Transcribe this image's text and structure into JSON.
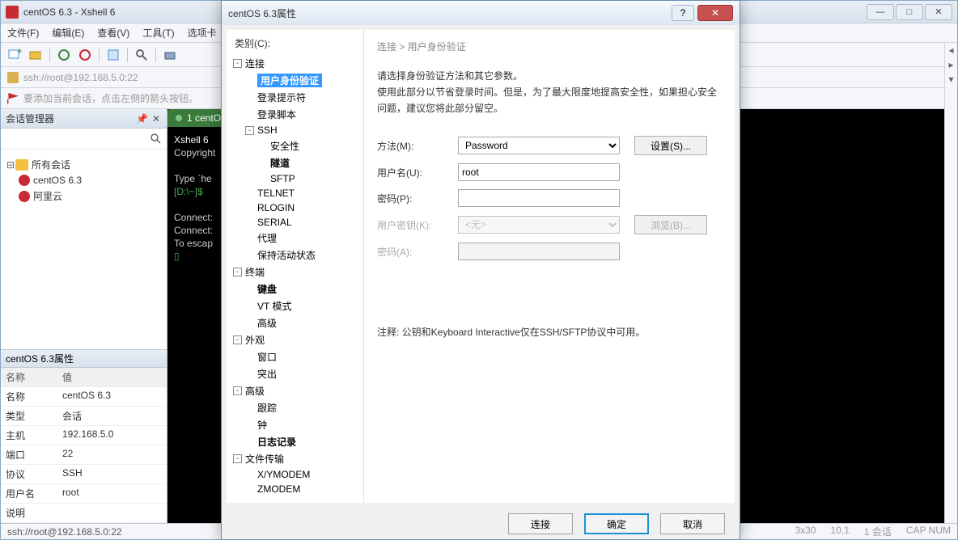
{
  "mainWindow": {
    "title": "centOS 6.3 - Xshell 6",
    "menu": [
      "文件(F)",
      "编辑(E)",
      "查看(V)",
      "工具(T)",
      "选项卡"
    ],
    "address": "ssh://root@192.168.5.0:22",
    "hint": "要添加当前会话，点击左侧的箭头按钮。"
  },
  "sidebar": {
    "title": "会话管理器",
    "root": "所有会话",
    "sessions": [
      "centOS 6.3",
      "阿里云"
    ]
  },
  "props": {
    "header": "centOS 6.3属性",
    "cols": {
      "name": "名称",
      "value": "值"
    },
    "rows": [
      {
        "k": "名称",
        "v": "centOS 6.3"
      },
      {
        "k": "类型",
        "v": "会话"
      },
      {
        "k": "主机",
        "v": "192.168.5.0"
      },
      {
        "k": "端口",
        "v": "22"
      },
      {
        "k": "协议",
        "v": "SSH"
      },
      {
        "k": "用户名",
        "v": "root"
      },
      {
        "k": "说明",
        "v": ""
      }
    ]
  },
  "terminal": {
    "tab": "1 centO",
    "line1": "Xshell 6",
    "line2": "Copyright",
    "line3": "Type `he",
    "prompt": "[D:\\~]$",
    "line5": "Connect:",
    "line6": "Connect:",
    "line7": "To escap"
  },
  "status": {
    "left": "ssh://root@192.168.5.0:22",
    "r1": "3x30",
    "r2": "10,1",
    "r3": "1 会话",
    "r4": "CAP  NUM"
  },
  "dialog": {
    "title": "centOS 6.3属性",
    "catLabel": "类别(C):",
    "tree": {
      "connection": "连接",
      "auth": "用户身份验证",
      "loginPrompt": "登录提示符",
      "loginScript": "登录脚本",
      "ssh": "SSH",
      "security": "安全性",
      "tunnel": "隧道",
      "sftp": "SFTP",
      "telnet": "TELNET",
      "rlogin": "RLOGIN",
      "serial": "SERIAL",
      "proxy": "代理",
      "keepalive": "保持活动状态",
      "terminal": "终端",
      "keyboard": "键盘",
      "vtmode": "VT 模式",
      "advanced1": "高级",
      "appearance": "外观",
      "window": "窗口",
      "highlight": "突出",
      "advanced2": "高级",
      "trace": "跟踪",
      "bell": "钟",
      "log": "日志记录",
      "filetransfer": "文件传输",
      "xymodem": "X/YMODEM",
      "zmodem": "ZMODEM"
    },
    "breadcrumb": "连接 > 用户身份验证",
    "desc1": "请选择身份验证方法和其它参数。",
    "desc2": "使用此部分以节省登录时间。但是，为了最大限度地提高安全性，如果担心安全问题，建议您将此部分留空。",
    "form": {
      "methodLabel": "方法(M):",
      "methodValue": "Password",
      "setBtn": "设置(S)...",
      "userLabel": "用户名(U):",
      "userValue": "root",
      "passLabel": "密码(P):",
      "passValue": "",
      "keyLabel": "用户密钥(K):",
      "keyValue": "<无>",
      "browseBtn": "浏览(B)...",
      "passphraseLabel": "密码(A):"
    },
    "note": "注释: 公钥和Keyboard Interactive仅在SSH/SFTP协议中可用。",
    "buttons": {
      "connect": "连接",
      "ok": "确定",
      "cancel": "取消"
    }
  }
}
